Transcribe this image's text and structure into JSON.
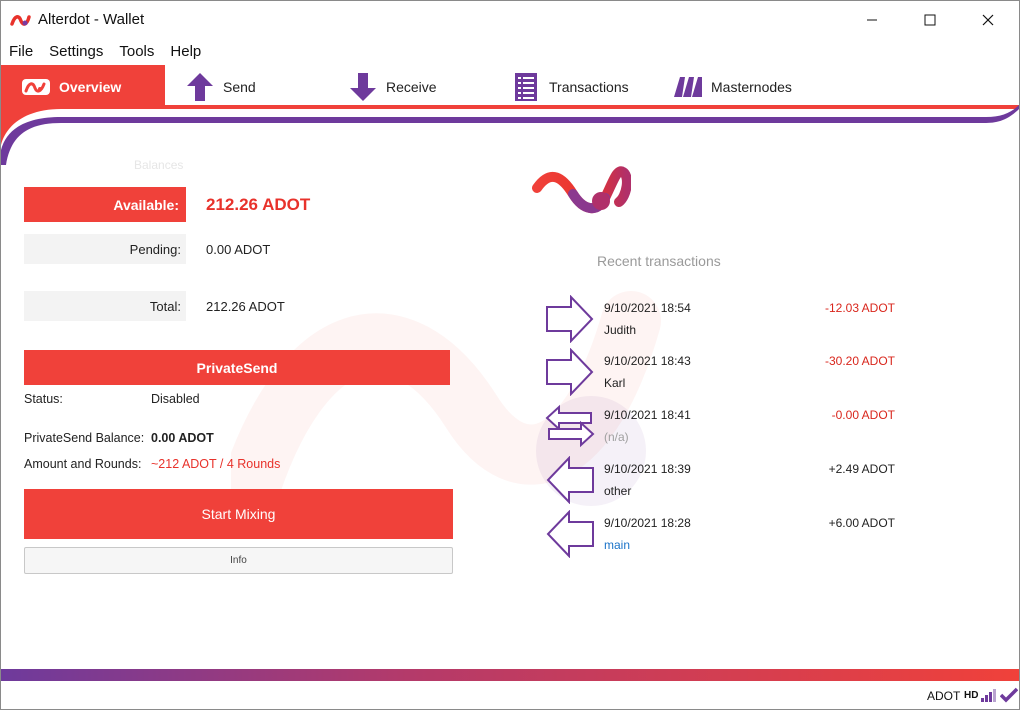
{
  "window": {
    "title": "Alterdot - Wallet"
  },
  "menu": [
    "File",
    "Settings",
    "Tools",
    "Help"
  ],
  "toolbar": {
    "tabs": [
      {
        "label": "Overview",
        "icon": "alterdot-logo-icon",
        "active": true
      },
      {
        "label": "Send",
        "icon": "arrow-up-icon"
      },
      {
        "label": "Receive",
        "icon": "arrow-down-icon"
      },
      {
        "label": "Transactions",
        "icon": "list-icon"
      },
      {
        "label": "Masternodes",
        "icon": "masternodes-icon"
      }
    ]
  },
  "balances": {
    "title": "Balances",
    "available_label": "Available:",
    "available_value": "212.26 ADOT",
    "pending_label": "Pending:",
    "pending_value": "0.00 ADOT",
    "total_label": "Total:",
    "total_value": "212.26 ADOT"
  },
  "privatesend": {
    "header": "PrivateSend",
    "status_label": "Status:",
    "status_value": "Disabled",
    "balance_label": "PrivateSend Balance:",
    "balance_value": "0.00 ADOT",
    "rounds_label": "Amount and Rounds:",
    "rounds_value": "~212 ADOT / 4 Rounds",
    "start_button": "Start Mixing",
    "info_button": "Info"
  },
  "recent": {
    "title": "Recent transactions",
    "items": [
      {
        "date": "9/10/2021 18:54",
        "label": "Judith",
        "amount": "-12.03 ADOT",
        "direction": "send"
      },
      {
        "date": "9/10/2021 18:43",
        "label": "Karl",
        "amount": "-30.20 ADOT",
        "direction": "send"
      },
      {
        "date": "9/10/2021 18:41",
        "label": "(n/a)",
        "amount": "-0.00 ADOT",
        "direction": "self"
      },
      {
        "date": "9/10/2021 18:39",
        "label": "other",
        "amount": "+2.49 ADOT",
        "direction": "receive"
      },
      {
        "date": "9/10/2021 18:28",
        "label": "main",
        "amount": "+6.00 ADOT",
        "direction": "receive"
      }
    ]
  },
  "statusbar": {
    "unit": "ADOT",
    "hd": "HD"
  },
  "colors": {
    "accent": "#f0413a",
    "purple": "#6e3a9c",
    "negative": "#d9261c"
  }
}
